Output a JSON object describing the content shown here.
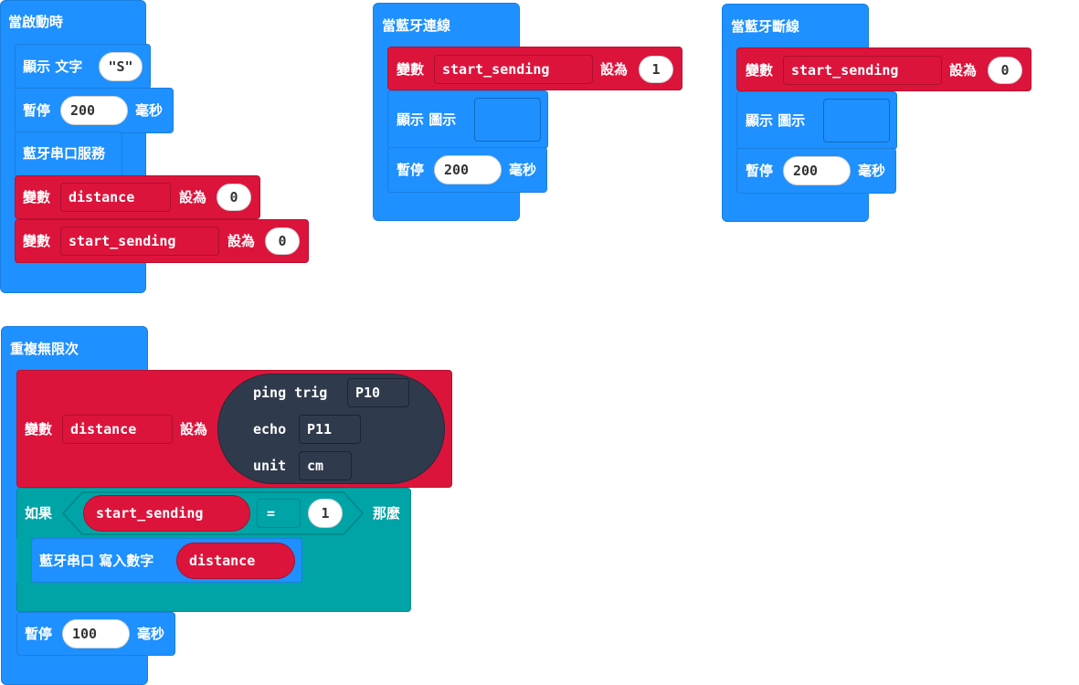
{
  "start": {
    "hat": "當啟動時",
    "show_text_label": "顯示 文字",
    "show_text_value": "\"S\"",
    "pause_label": "暫停",
    "pause_value": "200",
    "ms_label": "毫秒",
    "bt_uart_service": "藍牙串口服務",
    "var_label": "變數",
    "set_label": "設為",
    "var1_name": "distance",
    "var1_value": "0",
    "var2_name": "start_sending",
    "var2_value": "0"
  },
  "connected": {
    "hat": "當藍牙連線",
    "var_label": "變數",
    "var_name": "start_sending",
    "set_label": "設為",
    "var_value": "1",
    "show_image_label": "顯示 圖示",
    "pause_label": "暫停",
    "pause_value": "200",
    "ms_label": "毫秒"
  },
  "disconnected": {
    "hat": "當藍牙斷線",
    "var_label": "變數",
    "var_name": "start_sending",
    "set_label": "設為",
    "var_value": "0",
    "show_image_label": "顯示 圖示",
    "pause_label": "暫停",
    "pause_value": "200",
    "ms_label": "毫秒"
  },
  "forever": {
    "hat": "重複無限次",
    "var_label": "變數",
    "var_name": "distance",
    "set_label": "設為",
    "ping_trig_label": "ping trig",
    "ping_trig_value": "P10",
    "echo_label": "echo",
    "echo_value": "P11",
    "unit_label": "unit",
    "unit_value": "cm",
    "if_label": "如果",
    "cond_var": "start_sending",
    "cond_op": "=",
    "cond_value": "1",
    "then_label": "那麼",
    "bt_write_label": "藍牙串口 寫入數字",
    "bt_write_var": "distance",
    "pause_label": "暫停",
    "pause_value": "100",
    "ms_label": "毫秒"
  },
  "colors": {
    "basic_blue": "#1e90ff",
    "variables_red": "#dc143c",
    "logic_teal": "#00a4a6",
    "sonar_dark": "#2f3b4c"
  }
}
